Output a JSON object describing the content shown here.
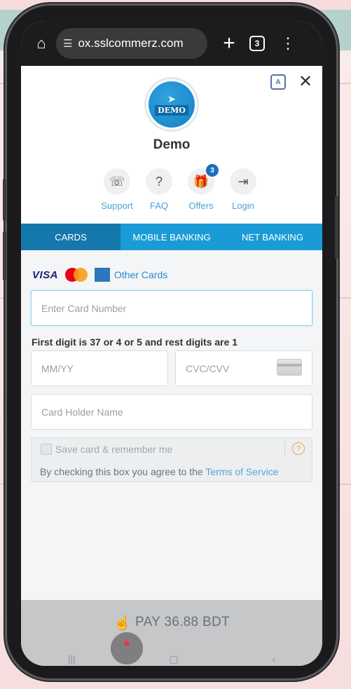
{
  "browser": {
    "url": "ox.sslcommerz.com",
    "tab_count": "3"
  },
  "merchant": {
    "logo_text": "DEMO",
    "name": "Demo"
  },
  "quick_links": [
    {
      "label": "Support",
      "icon": "headset-icon"
    },
    {
      "label": "FAQ",
      "icon": "question-icon"
    },
    {
      "label": "Offers",
      "icon": "gift-icon",
      "badge": "3"
    },
    {
      "label": "Login",
      "icon": "login-icon"
    }
  ],
  "tabs": [
    {
      "label": "CARDS",
      "active": true
    },
    {
      "label": "MOBILE BANKING",
      "active": false
    },
    {
      "label": "NET BANKING",
      "active": false
    }
  ],
  "card_form": {
    "brands": [
      "VISA",
      "Mastercard",
      "American Express"
    ],
    "visa_label": "VISA",
    "other_cards": "Other Cards",
    "card_number_placeholder": "Enter Card Number",
    "hint": "First digit is 37 or 4 or 5 and rest digits are 1",
    "expiry_placeholder": "MM/YY",
    "cvc_placeholder": "CVC/CVV",
    "holder_placeholder": "Card Holder Name",
    "save_label": "Save card & remember me",
    "agree_text": "By checking this box you agree to the",
    "terms_link": "Terms of Service"
  },
  "pay": {
    "label": "PAY 36.88 BDT"
  },
  "colors": {
    "primary": "#1a9bd6",
    "tab_active": "#1478ad",
    "link": "#4aa3d8",
    "badge": "#1f6fc0"
  }
}
